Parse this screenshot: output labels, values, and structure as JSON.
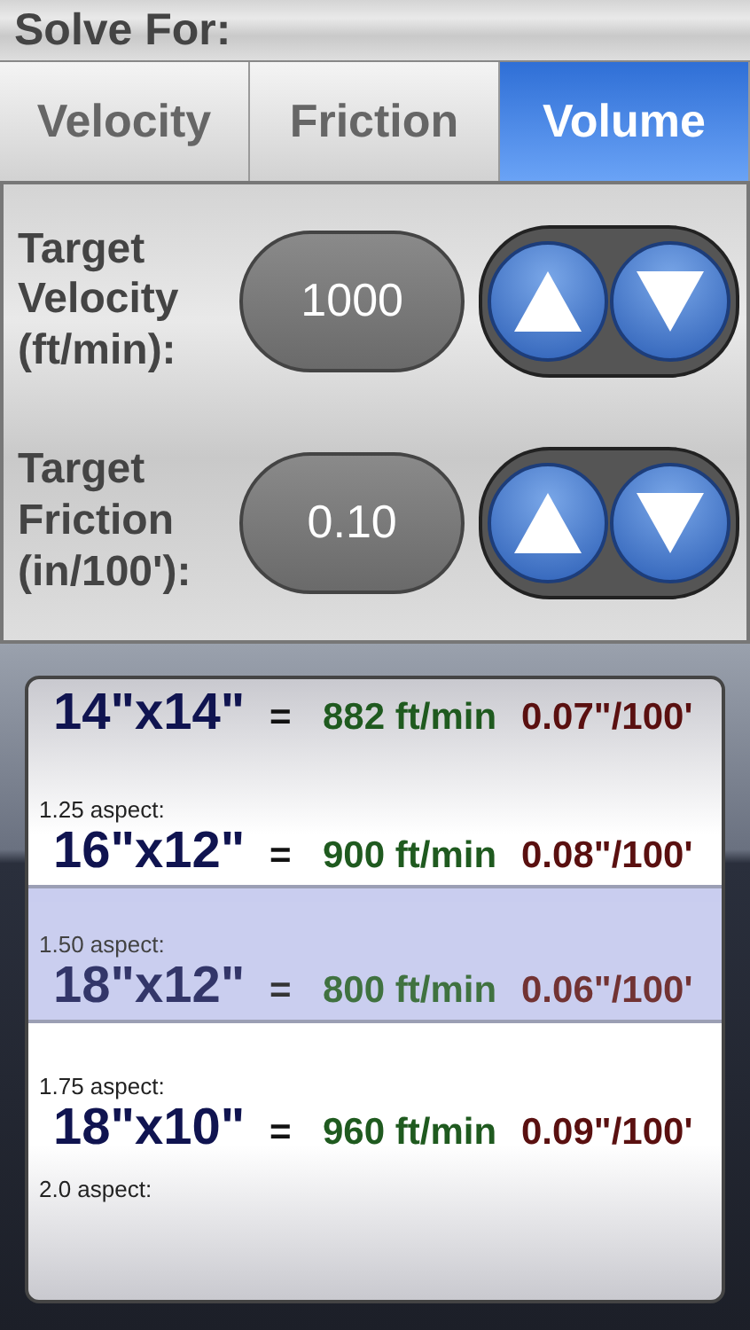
{
  "header": {
    "title": "Solve For:"
  },
  "tabs": [
    {
      "label": "Velocity",
      "selected": false
    },
    {
      "label": "Friction",
      "selected": false
    },
    {
      "label": "Volume",
      "selected": true
    }
  ],
  "inputs": [
    {
      "label": "Target Velocity (ft/min):",
      "value": "1000"
    },
    {
      "label": "Target Friction (in/100'):",
      "value": "0.10"
    }
  ],
  "picker": {
    "rows": [
      {
        "size": "14\"x14\"",
        "equals": "=",
        "velocity": "882 ft/min",
        "friction": "0.07\"/100'",
        "selected": false
      },
      {
        "aspect": "1.25 aspect:",
        "size": "16\"x12\"",
        "equals": "=",
        "velocity": "900 ft/min",
        "friction": "0.08\"/100'",
        "selected": false
      },
      {
        "aspect": "1.50 aspect:",
        "size": "18\"x12\"",
        "equals": "=",
        "velocity": "800 ft/min",
        "friction": "0.06\"/100'",
        "selected": true
      },
      {
        "aspect": "1.75 aspect:",
        "size": "18\"x10\"",
        "equals": "=",
        "velocity": "960 ft/min",
        "friction": "0.09\"/100'",
        "selected": false
      },
      {
        "aspect": "2.0 aspect:",
        "selected": false
      }
    ]
  }
}
